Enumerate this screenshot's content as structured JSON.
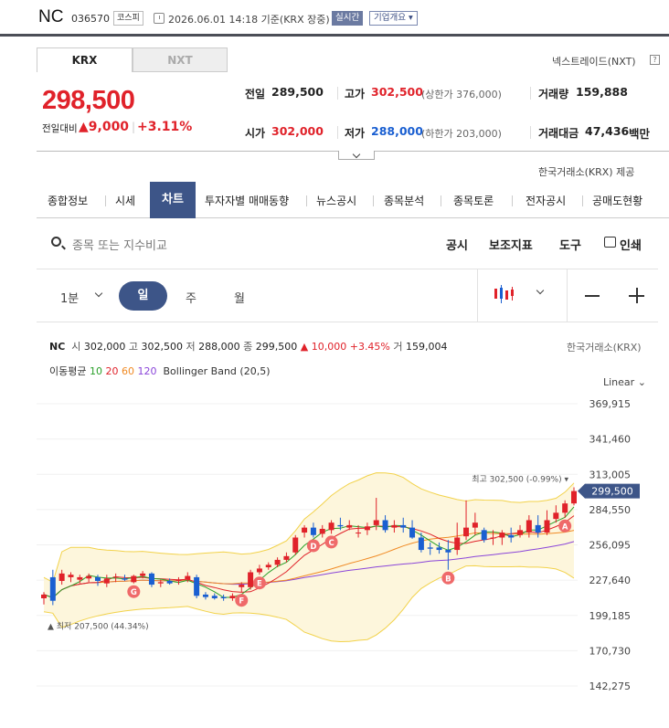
{
  "header": {
    "name": "NC",
    "code": "036570",
    "market": "코스피",
    "date": "2026.06.01 14:18 기준(KRX 장중)",
    "realtime": "실시간",
    "corp": "기업개요"
  },
  "tabs": {
    "krx": "KRX",
    "nxt": "NXT",
    "nxt_link": "넥스트레이드(NXT)",
    "help": "?"
  },
  "quote": {
    "price": "298,500",
    "change_label": "전일대비",
    "change": "▲9,000",
    "change_sep": "|",
    "change_pct": "+3.11%"
  },
  "stats": {
    "prev_label": "전일",
    "prev": "289,500",
    "high_label": "고가",
    "high": "302,500",
    "upper_limit": "(상한가 376,000)",
    "volume_label": "거래량",
    "volume": "159,888",
    "open_label": "시가",
    "open": "302,000",
    "low_label": "저가",
    "low": "288,000",
    "lower_limit": "(하한가 203,000)",
    "value_label": "거래대금",
    "value": "47,436",
    "value_unit": "백만"
  },
  "provider": "한국거래소(KRX) 제공",
  "nav": [
    "종합정보",
    "시세",
    "차트",
    "투자자별 매매동향",
    "뉴스공시",
    "종목분석",
    "종목토론",
    "전자공시",
    "공매도현황"
  ],
  "toolbar": {
    "search_placeholder": "종목 또는 지수비교",
    "disclosure": "공시",
    "indicators": "보조지표",
    "tools": "도구",
    "print": "인쇄"
  },
  "timeframes": {
    "minute": "1분",
    "day": "일",
    "week": "주",
    "month": "월"
  },
  "ohlc": {
    "name": "NC",
    "open_label": "시",
    "open": "302,000",
    "high_label": "고",
    "high": "302,500",
    "low_label": "저",
    "low": "288,000",
    "close_label": "종",
    "close": "299,500",
    "change": "▲ 10,000 +3.45%",
    "vol_label": "거",
    "volume": "159,004",
    "source": "한국거래소(KRX)"
  },
  "legend": {
    "ma_label": "이동평균",
    "ma": [
      "10",
      "20",
      "60",
      "120"
    ],
    "bb": "Bollinger Band (20,5)"
  },
  "scale": "Linear",
  "annotations": {
    "max": "최고 302,500 (-0.99%)",
    "min": "최저 207,500 (44.34%)",
    "last": "299,500",
    "markers": [
      "A",
      "B",
      "C",
      "D",
      "E",
      "F",
      "G"
    ]
  },
  "colors": {
    "up": "#e0222a",
    "down": "#1a5fd1",
    "accent": "#3d5588",
    "ma10": "#2aa02a",
    "ma20": "#e0222a",
    "ma60": "#f08a24",
    "ma120": "#8a45d9",
    "bb": "#f2d24a"
  },
  "chart_data": {
    "type": "candlestick",
    "yticks": [
      "369,915",
      "341,460",
      "313,005",
      "284,550",
      "256,095",
      "227,640",
      "199,185",
      "170,730",
      "142,275"
    ],
    "ylim": [
      142275,
      369915
    ],
    "candles": [
      {
        "o": 213000,
        "h": 218000,
        "l": 208000,
        "c": 216000
      },
      {
        "o": 230000,
        "h": 236000,
        "l": 207500,
        "c": 211000
      },
      {
        "o": 227000,
        "h": 236000,
        "l": 224000,
        "c": 233000
      },
      {
        "o": 230000,
        "h": 234000,
        "l": 226000,
        "c": 232000
      },
      {
        "o": 228000,
        "h": 232000,
        "l": 225000,
        "c": 230000
      },
      {
        "o": 229000,
        "h": 233000,
        "l": 226000,
        "c": 231000
      },
      {
        "o": 230000,
        "h": 232000,
        "l": 223000,
        "c": 227000
      },
      {
        "o": 225000,
        "h": 232000,
        "l": 222000,
        "c": 229000
      },
      {
        "o": 230000,
        "h": 233000,
        "l": 226000,
        "c": 230500
      },
      {
        "o": 229000,
        "h": 232000,
        "l": 227000,
        "c": 228000
      },
      {
        "o": 226000,
        "h": 232000,
        "l": 225000,
        "c": 231000
      },
      {
        "o": 231000,
        "h": 235000,
        "l": 229000,
        "c": 233000
      },
      {
        "o": 233000,
        "h": 234000,
        "l": 222000,
        "c": 224000
      },
      {
        "o": 225000,
        "h": 228000,
        "l": 222000,
        "c": 226000
      },
      {
        "o": 227000,
        "h": 229000,
        "l": 224000,
        "c": 225000
      },
      {
        "o": 227000,
        "h": 230000,
        "l": 224000,
        "c": 228000
      },
      {
        "o": 228000,
        "h": 234000,
        "l": 226000,
        "c": 231000
      },
      {
        "o": 230000,
        "h": 232000,
        "l": 213000,
        "c": 215000
      },
      {
        "o": 216000,
        "h": 218000,
        "l": 212000,
        "c": 214000
      },
      {
        "o": 215000,
        "h": 217000,
        "l": 212000,
        "c": 213000
      },
      {
        "o": 214000,
        "h": 216000,
        "l": 211000,
        "c": 213000
      },
      {
        "o": 213000,
        "h": 217000,
        "l": 211000,
        "c": 215000
      },
      {
        "o": 222000,
        "h": 226000,
        "l": 218000,
        "c": 224000
      },
      {
        "o": 222000,
        "h": 236000,
        "l": 220000,
        "c": 234000
      },
      {
        "o": 234000,
        "h": 240000,
        "l": 232000,
        "c": 237000
      },
      {
        "o": 238000,
        "h": 242000,
        "l": 236000,
        "c": 240000
      },
      {
        "o": 240000,
        "h": 246000,
        "l": 238000,
        "c": 244000
      },
      {
        "o": 244000,
        "h": 250000,
        "l": 242000,
        "c": 247000
      },
      {
        "o": 250000,
        "h": 264000,
        "l": 248000,
        "c": 262000
      },
      {
        "o": 266000,
        "h": 272000,
        "l": 262000,
        "c": 270000
      },
      {
        "o": 270000,
        "h": 274000,
        "l": 262000,
        "c": 264000
      },
      {
        "o": 265000,
        "h": 272000,
        "l": 262000,
        "c": 269000
      },
      {
        "o": 268000,
        "h": 276000,
        "l": 265000,
        "c": 274000
      },
      {
        "o": 272000,
        "h": 278000,
        "l": 268000,
        "c": 271000
      },
      {
        "o": 270000,
        "h": 276000,
        "l": 268000,
        "c": 272000
      },
      {
        "o": 266000,
        "h": 272000,
        "l": 262000,
        "c": 266000
      },
      {
        "o": 268000,
        "h": 274000,
        "l": 264000,
        "c": 271000
      },
      {
        "o": 272000,
        "h": 294000,
        "l": 268000,
        "c": 276000
      },
      {
        "o": 276000,
        "h": 280000,
        "l": 266000,
        "c": 268000
      },
      {
        "o": 270000,
        "h": 276000,
        "l": 266000,
        "c": 272000
      },
      {
        "o": 272000,
        "h": 278000,
        "l": 266000,
        "c": 270000
      },
      {
        "o": 270000,
        "h": 276000,
        "l": 261000,
        "c": 262000
      },
      {
        "o": 262000,
        "h": 266000,
        "l": 250000,
        "c": 252000
      },
      {
        "o": 254000,
        "h": 258000,
        "l": 248000,
        "c": 253000
      },
      {
        "o": 254000,
        "h": 258000,
        "l": 249000,
        "c": 252000
      },
      {
        "o": 252000,
        "h": 260000,
        "l": 236000,
        "c": 250000
      },
      {
        "o": 252000,
        "h": 274000,
        "l": 248000,
        "c": 262000
      },
      {
        "o": 263000,
        "h": 292000,
        "l": 260000,
        "c": 270000
      },
      {
        "o": 270000,
        "h": 282000,
        "l": 264000,
        "c": 274000
      },
      {
        "o": 268000,
        "h": 270000,
        "l": 258000,
        "c": 260000
      },
      {
        "o": 262000,
        "h": 268000,
        "l": 256000,
        "c": 262000
      },
      {
        "o": 262000,
        "h": 268000,
        "l": 256000,
        "c": 266000
      },
      {
        "o": 264000,
        "h": 270000,
        "l": 258000,
        "c": 262000
      },
      {
        "o": 264000,
        "h": 272000,
        "l": 262000,
        "c": 268000
      },
      {
        "o": 266000,
        "h": 280000,
        "l": 262000,
        "c": 276000
      },
      {
        "o": 272000,
        "h": 280000,
        "l": 262000,
        "c": 266000
      },
      {
        "o": 266000,
        "h": 284000,
        "l": 264000,
        "c": 276000
      },
      {
        "o": 277000,
        "h": 288000,
        "l": 274000,
        "c": 282000
      },
      {
        "o": 282000,
        "h": 292000,
        "l": 278000,
        "c": 289500
      },
      {
        "o": 289500,
        "h": 302500,
        "l": 288000,
        "c": 299500
      }
    ]
  }
}
